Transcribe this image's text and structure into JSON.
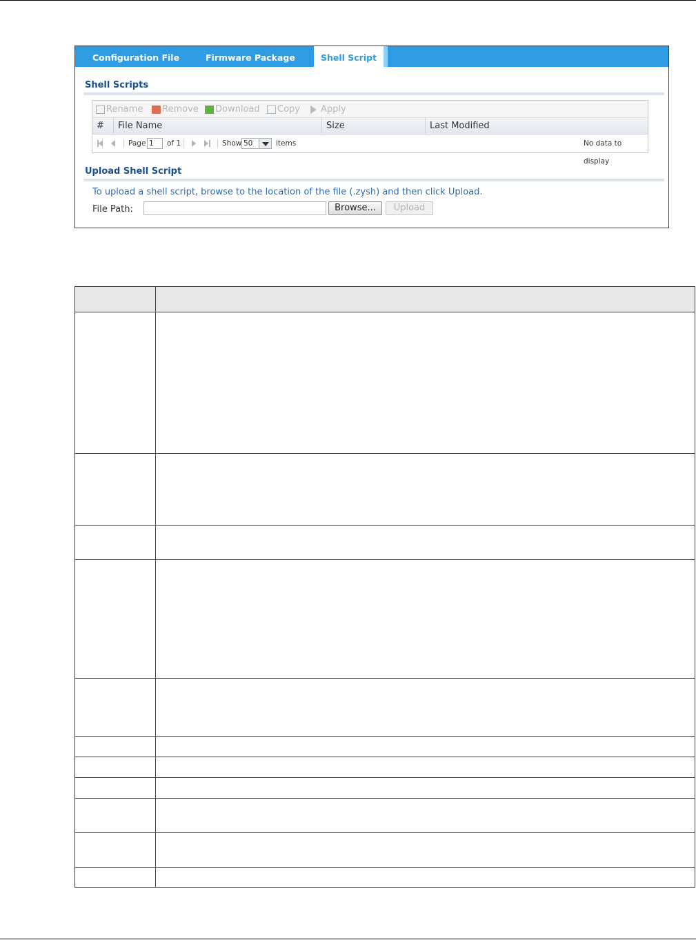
{
  "tabs": [
    {
      "label": "Configuration File"
    },
    {
      "label": "Firmware Package"
    },
    {
      "label": "Shell Script"
    }
  ],
  "shell_scripts": {
    "title": "Shell Scripts",
    "toolbar": {
      "rename": "Rename",
      "remove": "Remove",
      "download": "Download",
      "copy": "Copy",
      "apply": "Apply"
    },
    "columns": {
      "num": "#",
      "file_name": "File Name",
      "size": "Size",
      "last_modified": "Last Modified"
    },
    "pager": {
      "page_label": "Page",
      "page_value": "1",
      "of_label": "of 1",
      "show_label": "Show",
      "show_value": "50",
      "items_label": "items",
      "empty_text": "No data to display"
    }
  },
  "upload": {
    "title": "Upload Shell Script",
    "instruction": "To upload a shell script, browse to the location of the file (.zysh) and then click Upload.",
    "file_path_label": "File Path:",
    "file_path_value": "",
    "browse_label": "Browse...",
    "upload_label": "Upload"
  },
  "colors": {
    "tab_bar": "#2f9be3",
    "section_title": "#1a4f8e",
    "link_text": "#2c6db5"
  }
}
